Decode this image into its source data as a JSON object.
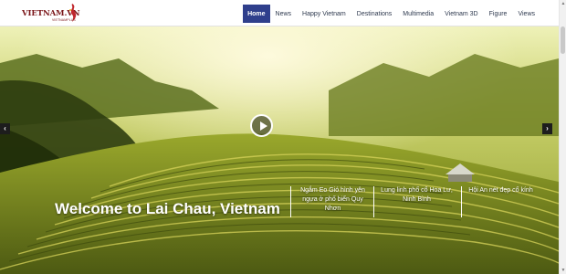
{
  "brand": {
    "name": "VIETNAM.VN",
    "tagline": "VIETNAMPLUS",
    "color": "#7a1518"
  },
  "nav": {
    "items": [
      {
        "label": "Home",
        "active": true
      },
      {
        "label": "News",
        "active": false
      },
      {
        "label": "Happy Vietnam",
        "active": false
      },
      {
        "label": "Destinations",
        "active": false
      },
      {
        "label": "Multimedia",
        "active": false
      },
      {
        "label": "Vietnam 3D",
        "active": false
      },
      {
        "label": "Figure",
        "active": false
      },
      {
        "label": "Views",
        "active": false
      }
    ],
    "active_color": "#2f3f8c"
  },
  "hero": {
    "title": "Welcome to Lai Chau, Vietnam",
    "prev_icon": "chevron-left-icon",
    "next_icon": "chevron-right-icon",
    "play_icon": "play-icon",
    "prev_glyph": "‹",
    "next_glyph": "›",
    "stories": [
      {
        "title": "Ngắm Eo Gió hình yên ngựa ở phố biển Quy Nhơn"
      },
      {
        "title": "Lung linh phố cổ Hoa Lư, Ninh Bình"
      },
      {
        "title": "Hội An nét đẹp cổ kính"
      }
    ]
  },
  "scrollbar": {
    "up_glyph": "▲",
    "down_glyph": "▼"
  }
}
